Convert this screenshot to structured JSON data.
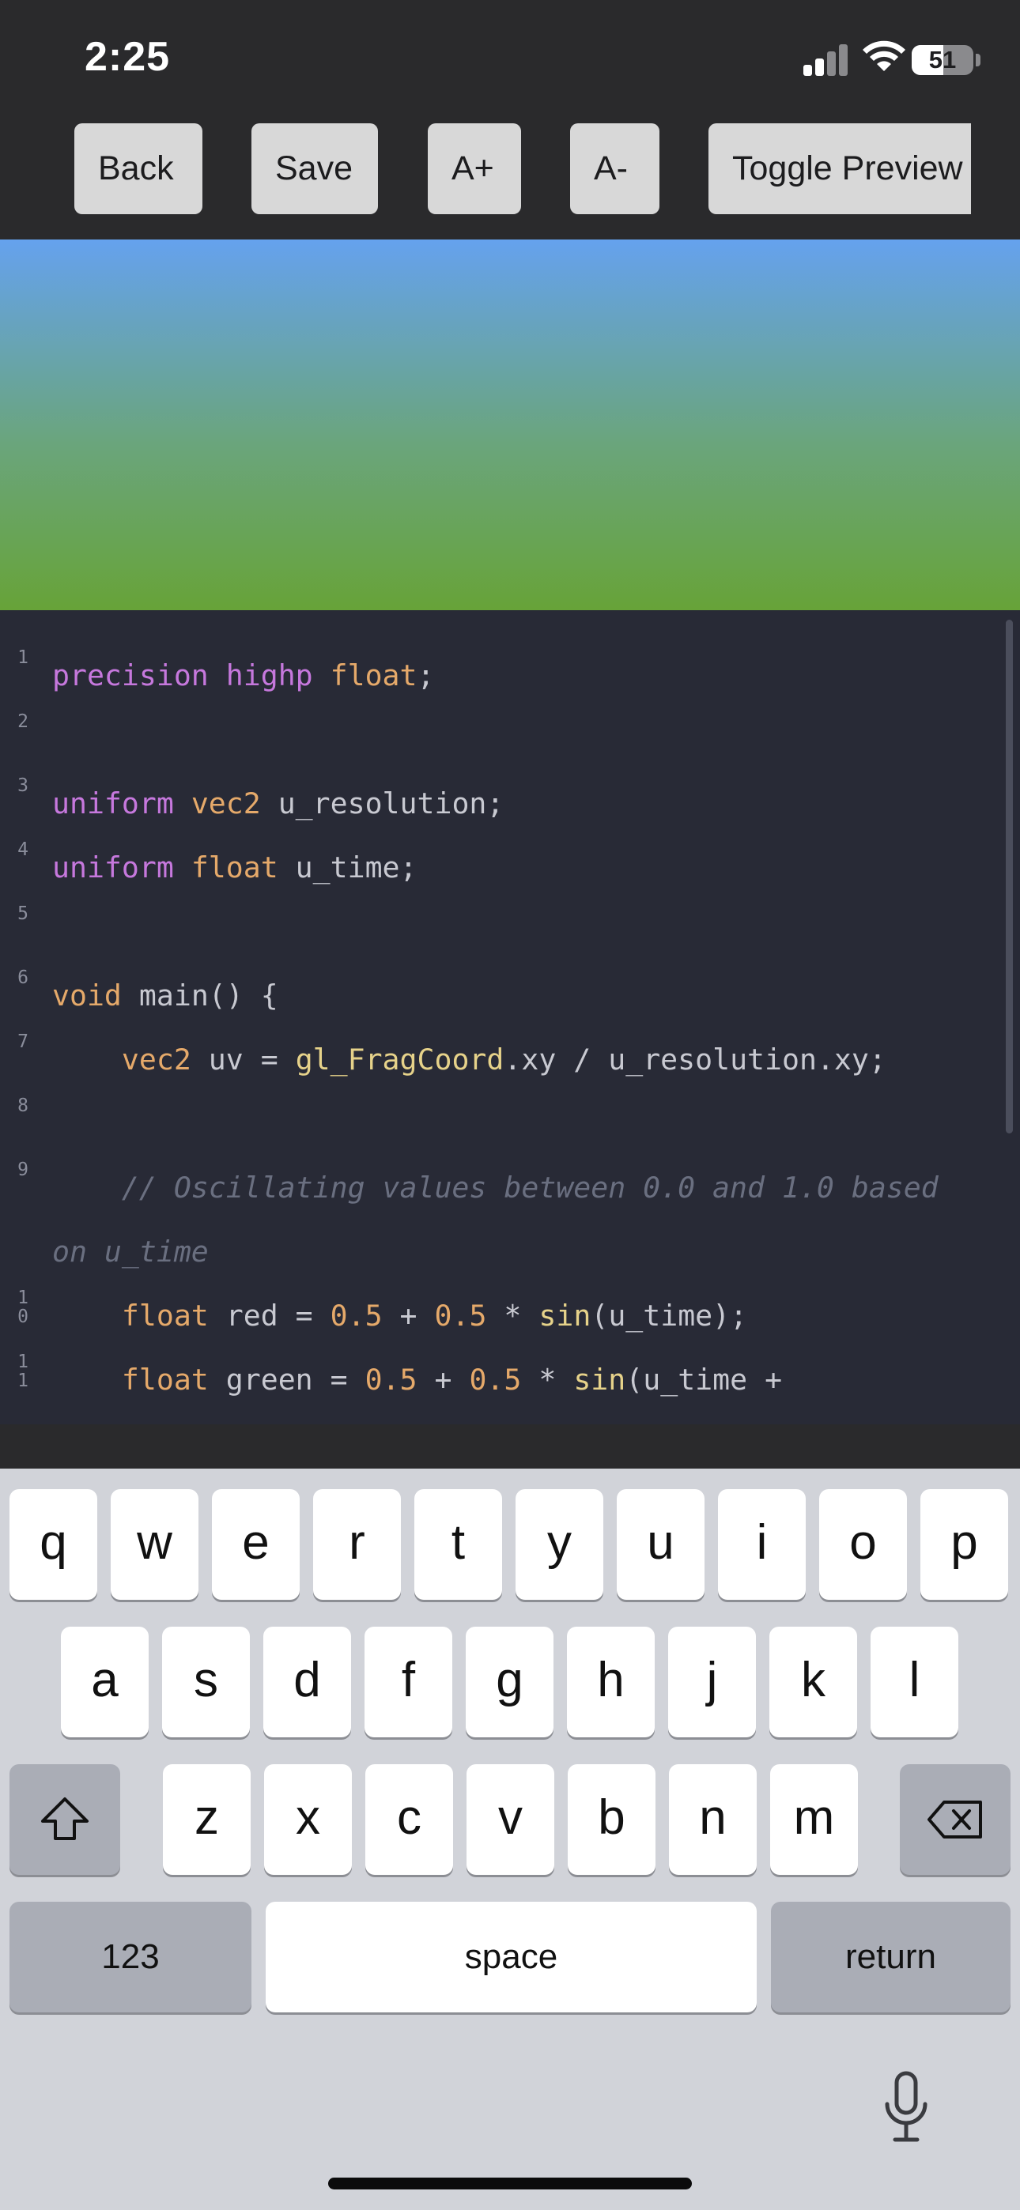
{
  "status_bar": {
    "time": "2:25",
    "battery": "51",
    "battery_level": 0.51
  },
  "toolbar": {
    "buttons": [
      {
        "label": "Back"
      },
      {
        "label": "Save"
      },
      {
        "label": "A+"
      },
      {
        "label": "A-"
      },
      {
        "label": "Toggle Preview"
      }
    ]
  },
  "preview": {
    "gradient_top": "#65a2ee",
    "gradient_bottom": "#67a338"
  },
  "editor": {
    "lines": [
      {
        "ln": "1",
        "tokens": [
          [
            "kw",
            "precision"
          ],
          [
            "op",
            " "
          ],
          [
            "kw",
            "highp"
          ],
          [
            "op",
            " "
          ],
          [
            "type",
            "float"
          ],
          [
            "op",
            ";"
          ]
        ]
      },
      {
        "ln": "2",
        "tokens": []
      },
      {
        "ln": "3",
        "tokens": [
          [
            "kw",
            "uniform"
          ],
          [
            "op",
            " "
          ],
          [
            "type",
            "vec2"
          ],
          [
            "op",
            " "
          ],
          [
            "id",
            "u_resolution"
          ],
          [
            "op",
            ";"
          ]
        ]
      },
      {
        "ln": "4",
        "tokens": [
          [
            "kw",
            "uniform"
          ],
          [
            "op",
            " "
          ],
          [
            "type",
            "float"
          ],
          [
            "op",
            " "
          ],
          [
            "id",
            "u_time"
          ],
          [
            "op",
            ";"
          ]
        ]
      },
      {
        "ln": "5",
        "tokens": []
      },
      {
        "ln": "6",
        "tokens": [
          [
            "type",
            "void"
          ],
          [
            "op",
            " "
          ],
          [
            "id",
            "main"
          ],
          [
            "op",
            "() {"
          ]
        ]
      },
      {
        "ln": "7",
        "tokens": [
          [
            "op",
            "    "
          ],
          [
            "type",
            "vec2"
          ],
          [
            "op",
            " "
          ],
          [
            "id",
            "uv"
          ],
          [
            "op",
            " = "
          ],
          [
            "fn",
            "gl_FragCoord"
          ],
          [
            "op",
            ".xy / "
          ],
          [
            "id",
            "u_resolution"
          ],
          [
            "op",
            ".xy;"
          ]
        ]
      },
      {
        "ln": "8",
        "tokens": []
      },
      {
        "ln": "9",
        "tokens": [
          [
            "cm",
            "    // Oscillating values between 0.0 and 1.0 based"
          ]
        ]
      },
      {
        "ln": "",
        "tokens": [
          [
            "cm",
            "on u_time"
          ]
        ]
      },
      {
        "ln": "10",
        "tokens": [
          [
            "op",
            "    "
          ],
          [
            "type",
            "float"
          ],
          [
            "op",
            " "
          ],
          [
            "id",
            "red"
          ],
          [
            "op",
            " = "
          ],
          [
            "num",
            "0.5"
          ],
          [
            "op",
            " + "
          ],
          [
            "num",
            "0.5"
          ],
          [
            "op",
            " * "
          ],
          [
            "fn",
            "sin"
          ],
          [
            "op",
            "("
          ],
          [
            "id",
            "u_time"
          ],
          [
            "op",
            ");"
          ]
        ]
      },
      {
        "ln": "11",
        "tokens": [
          [
            "op",
            "    "
          ],
          [
            "type",
            "float"
          ],
          [
            "op",
            " "
          ],
          [
            "id",
            "green"
          ],
          [
            "op",
            " = "
          ],
          [
            "num",
            "0.5"
          ],
          [
            "op",
            " + "
          ],
          [
            "num",
            "0.5"
          ],
          [
            "op",
            " * "
          ],
          [
            "fn",
            "sin"
          ],
          [
            "op",
            "("
          ],
          [
            "id",
            "u_time"
          ],
          [
            "op",
            " +"
          ]
        ]
      }
    ]
  },
  "keyboard": {
    "row1": [
      "q",
      "w",
      "e",
      "r",
      "t",
      "y",
      "u",
      "i",
      "o",
      "p"
    ],
    "row2": [
      "a",
      "s",
      "d",
      "f",
      "g",
      "h",
      "j",
      "k",
      "l"
    ],
    "row3": [
      "z",
      "x",
      "c",
      "v",
      "b",
      "n",
      "m"
    ],
    "numbers_label": "123",
    "space_label": "space",
    "return_label": "return"
  },
  "icons": {
    "shift": "shift-icon",
    "delete": "delete-icon",
    "mic": "microphone-icon",
    "wifi": "wifi-icon",
    "signal": "cellular-signal-icon",
    "battery": "battery-icon"
  }
}
